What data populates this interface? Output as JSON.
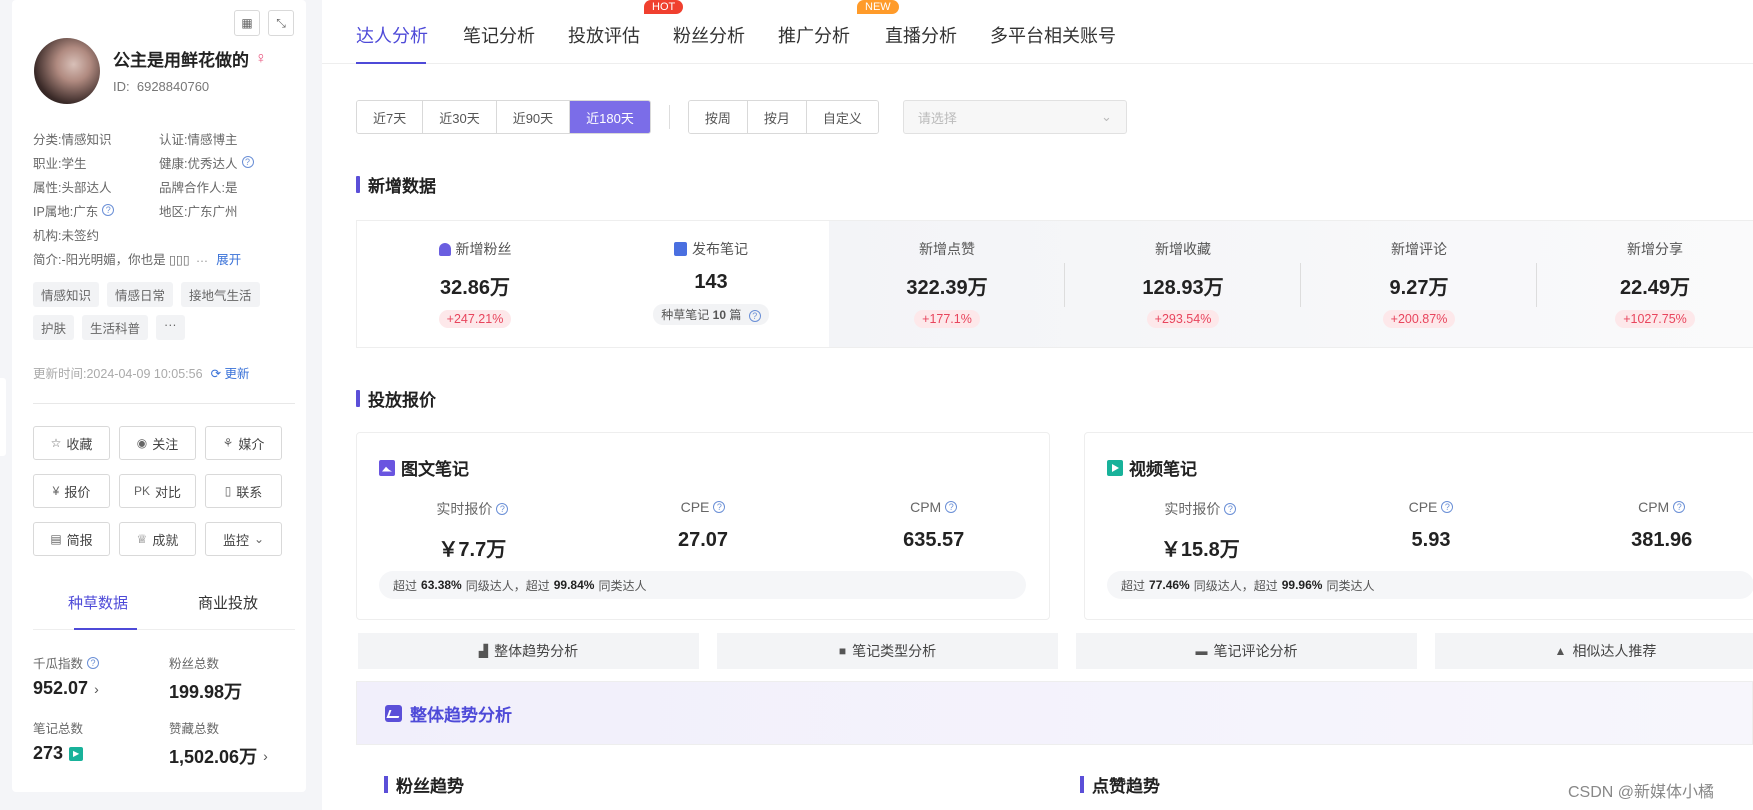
{
  "profile": {
    "nickname": "公主是用鲜花做的",
    "gender_icon": "female-icon",
    "id_label": "ID:",
    "id": "6928840760",
    "info": [
      [
        {
          "k": "分类:",
          "v": "情感知识"
        },
        {
          "k": "认证:",
          "v": "情感博主"
        }
      ],
      [
        {
          "k": "职业:",
          "v": "学生"
        },
        {
          "k": "健康:",
          "v": "优秀达人"
        }
      ],
      [
        {
          "k": "属性:",
          "v": "头部达人"
        },
        {
          "k": "品牌合作人:",
          "v": "是"
        }
      ],
      [
        {
          "k": "IP属地:",
          "v": "广东"
        },
        {
          "k": "地区:",
          "v": "广东广州"
        }
      ]
    ],
    "org_label": "机构:",
    "org": "未签约",
    "intro_label": "简介:",
    "intro": "-阳光明媚，你也是 ▯▯▯",
    "expand": "展开",
    "tags": [
      "情感知识",
      "情感日常",
      "接地气生活",
      "护肤",
      "生活科普",
      "···"
    ],
    "update_label": "更新时间:",
    "update_time": "2024-04-09 10:05:56",
    "update_btn": "更新",
    "buttons": [
      {
        "label": "收藏",
        "icon": "☆",
        "name": "favorite-button",
        "icon_name": "star-icon"
      },
      {
        "label": "关注",
        "icon": "◉",
        "name": "follow-button",
        "icon_name": "eye-icon"
      },
      {
        "label": "媒介",
        "icon": "⚘",
        "name": "media-button",
        "icon_name": "media-icon"
      },
      {
        "label": "报价",
        "icon": "¥",
        "name": "quote-button",
        "icon_name": "yuan-icon"
      },
      {
        "label": "对比",
        "icon": "PK",
        "name": "compare-button",
        "icon_name": "pk-icon"
      },
      {
        "label": "联系",
        "icon": "▯",
        "name": "contact-button",
        "icon_name": "phone-icon"
      },
      {
        "label": "简报",
        "icon": "▤",
        "name": "brief-button",
        "icon_name": "report-icon"
      },
      {
        "label": "成就",
        "icon": "♕",
        "name": "achievement-button",
        "icon_name": "crown-icon"
      },
      {
        "label": "监控",
        "icon": "⌄",
        "name": "monitor-button",
        "icon_name": "chevron-down-icon"
      }
    ],
    "tabs": [
      "种草数据",
      "商业投放"
    ],
    "stats": [
      {
        "label": "千瓜指数",
        "value": "952.07"
      },
      {
        "label": "粉丝总数",
        "value": "199.98万"
      },
      {
        "label": "笔记总数",
        "value": "273"
      },
      {
        "label": "赞藏总数",
        "value": "1,502.06万"
      }
    ]
  },
  "nav": {
    "tabs": [
      "达人分析",
      "笔记分析",
      "投放评估",
      "粉丝分析",
      "推广分析",
      "直播分析",
      "多平台相关账号"
    ],
    "badge_hot": "HOT",
    "badge_new": "NEW"
  },
  "filters": {
    "ranges": [
      "近7天",
      "近30天",
      "近90天",
      "近180天"
    ],
    "active_range": "近180天",
    "granularity": [
      "按周",
      "按月",
      "自定义"
    ],
    "select_placeholder": "请选择"
  },
  "new_data": {
    "title": "新增数据",
    "metrics": [
      {
        "label": "新增粉丝",
        "value": "32.86万",
        "change": "+247.21%"
      },
      {
        "label": "发布笔记",
        "value": "143",
        "note_label": "种草笔记",
        "note_count": "10",
        "note_unit": "篇"
      },
      {
        "label": "新增点赞",
        "value": "322.39万",
        "change": "+177.1%"
      },
      {
        "label": "新增收藏",
        "value": "128.93万",
        "change": "+293.54%"
      },
      {
        "label": "新增评论",
        "value": "9.27万",
        "change": "+200.87%"
      },
      {
        "label": "新增分享",
        "value": "22.49万",
        "change": "+1027.75%"
      }
    ]
  },
  "pricing": {
    "title": "投放报价",
    "cards": [
      {
        "title": "图文笔记",
        "cols": [
          {
            "label": "实时报价",
            "value": "￥7.7万"
          },
          {
            "label": "CPE",
            "value": "27.07"
          },
          {
            "label": "CPM",
            "value": "635.57"
          }
        ],
        "foot": {
          "p1": "超过",
          "v1": "63.38%",
          "p2": "同级达人，超过",
          "v2": "99.84%",
          "p3": "同类达人"
        }
      },
      {
        "title": "视频笔记",
        "cols": [
          {
            "label": "实时报价",
            "value": "￥15.8万"
          },
          {
            "label": "CPE",
            "value": "5.93"
          },
          {
            "label": "CPM",
            "value": "381.96"
          }
        ],
        "foot": {
          "p1": "超过",
          "v1": "77.46%",
          "p2": "同级达人，超过",
          "v2": "99.96%",
          "p3": "同类达人"
        }
      }
    ]
  },
  "analysis_tabs": [
    {
      "label": "整体趋势分析",
      "icon": "▟"
    },
    {
      "label": "笔记类型分析",
      "icon": "■"
    },
    {
      "label": "笔记评论分析",
      "icon": "▬"
    },
    {
      "label": "相似达人推荐",
      "icon": "▲"
    }
  ],
  "trend": {
    "title": "整体趋势分析",
    "fans_trend": "粉丝趋势",
    "likes_trend": "点赞趋势"
  },
  "watermark": "CSDN @新媒体小橘"
}
